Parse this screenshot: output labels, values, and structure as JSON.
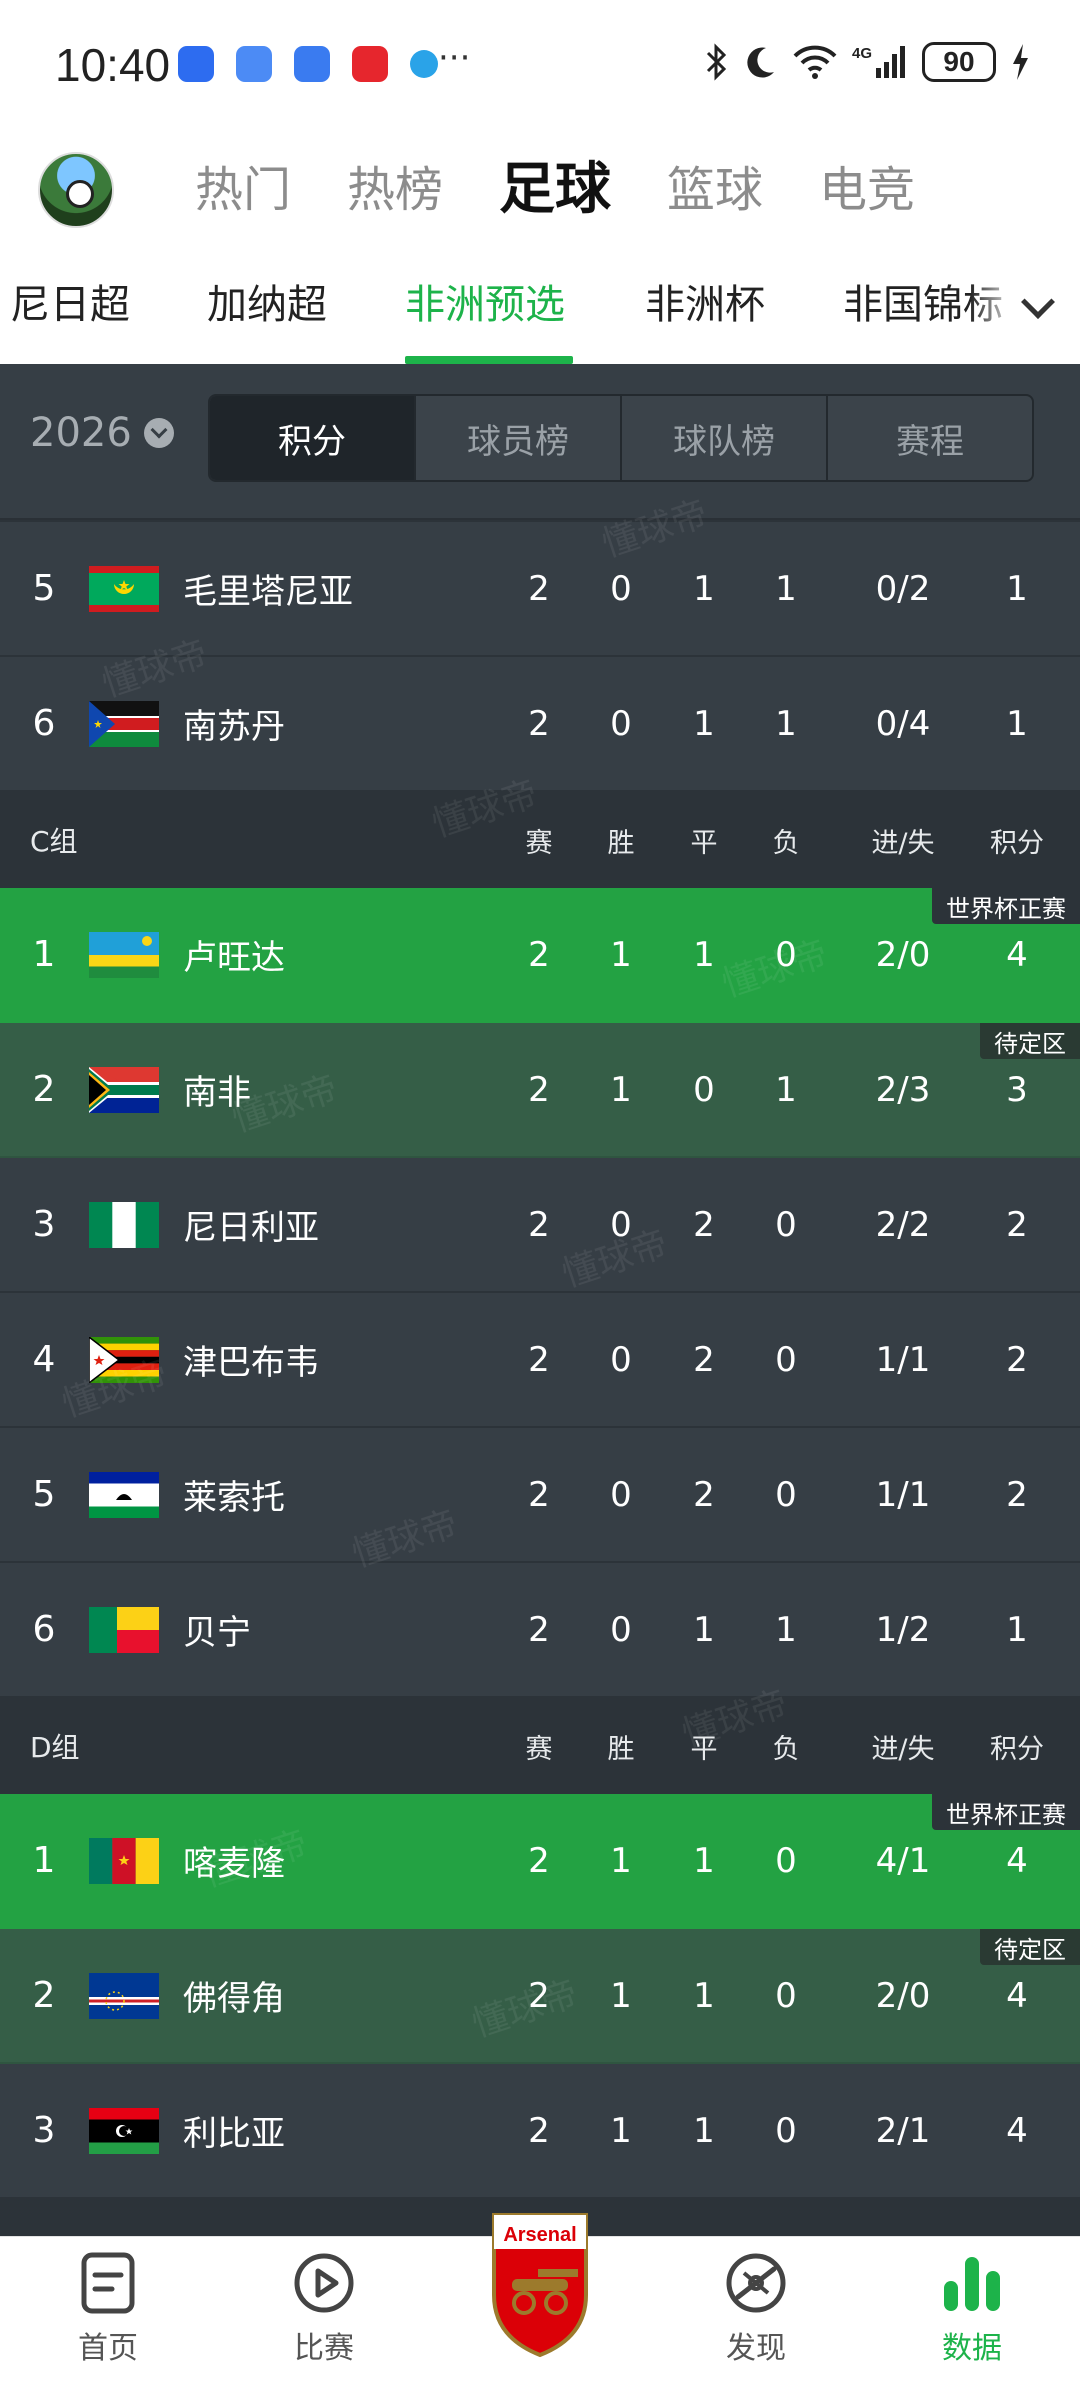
{
  "status_bar": {
    "time": "10:40",
    "dots": "···",
    "battery": "90"
  },
  "sport_tabs": [
    "热门",
    "热榜",
    "足球",
    "篮球",
    "电竞"
  ],
  "league_tabs": [
    "尼日超",
    "加纳超",
    "非洲预选",
    "非洲杯",
    "非国锦标"
  ],
  "filter": {
    "season": "2026",
    "segments": [
      "积分",
      "球员榜",
      "球队榜",
      "赛程"
    ]
  },
  "columns": {
    "played": "赛",
    "won": "胜",
    "drawn": "平",
    "lost": "负",
    "goals": "进/失",
    "points": "积分"
  },
  "zone_labels": {
    "qualify": "世界杯正赛",
    "pending": "待定区"
  },
  "group_b_tail": [
    {
      "rank": "5",
      "team": "毛里塔尼亚",
      "p": "2",
      "w": "0",
      "d": "1",
      "l": "1",
      "g": "0/2",
      "pts": "1"
    },
    {
      "rank": "6",
      "team": "南苏丹",
      "p": "2",
      "w": "0",
      "d": "1",
      "l": "1",
      "g": "0/4",
      "pts": "1"
    }
  ],
  "group_c": {
    "name": "C组",
    "rows": [
      {
        "rank": "1",
        "team": "卢旺达",
        "p": "2",
        "w": "1",
        "d": "1",
        "l": "0",
        "g": "2/0",
        "pts": "4"
      },
      {
        "rank": "2",
        "team": "南非",
        "p": "2",
        "w": "1",
        "d": "0",
        "l": "1",
        "g": "2/3",
        "pts": "3"
      },
      {
        "rank": "3",
        "team": "尼日利亚",
        "p": "2",
        "w": "0",
        "d": "2",
        "l": "0",
        "g": "2/2",
        "pts": "2"
      },
      {
        "rank": "4",
        "team": "津巴布韦",
        "p": "2",
        "w": "0",
        "d": "2",
        "l": "0",
        "g": "1/1",
        "pts": "2"
      },
      {
        "rank": "5",
        "team": "莱索托",
        "p": "2",
        "w": "0",
        "d": "2",
        "l": "0",
        "g": "1/1",
        "pts": "2"
      },
      {
        "rank": "6",
        "team": "贝宁",
        "p": "2",
        "w": "0",
        "d": "1",
        "l": "1",
        "g": "1/2",
        "pts": "1"
      }
    ]
  },
  "group_d": {
    "name": "D组",
    "rows": [
      {
        "rank": "1",
        "team": "喀麦隆",
        "p": "2",
        "w": "1",
        "d": "1",
        "l": "0",
        "g": "4/1",
        "pts": "4"
      },
      {
        "rank": "2",
        "team": "佛得角",
        "p": "2",
        "w": "1",
        "d": "1",
        "l": "0",
        "g": "2/0",
        "pts": "4"
      },
      {
        "rank": "3",
        "team": "利比亚",
        "p": "2",
        "w": "1",
        "d": "1",
        "l": "0",
        "g": "2/1",
        "pts": "4"
      }
    ]
  },
  "watermark": "懂球帝",
  "bottom_nav": [
    {
      "label": "首页",
      "icon": "home-doc-icon"
    },
    {
      "label": "比赛",
      "icon": "play-circle-icon"
    },
    {
      "label": "Arsenal",
      "icon": "arsenal-crest-icon"
    },
    {
      "label": "发现",
      "icon": "discover-ball-icon"
    },
    {
      "label": "数据",
      "icon": "bar-chart-icon"
    }
  ],
  "colors": {
    "accent": "#1db34a",
    "qualify": "#23a243",
    "pending": "#355e47",
    "row": "#363e45"
  }
}
